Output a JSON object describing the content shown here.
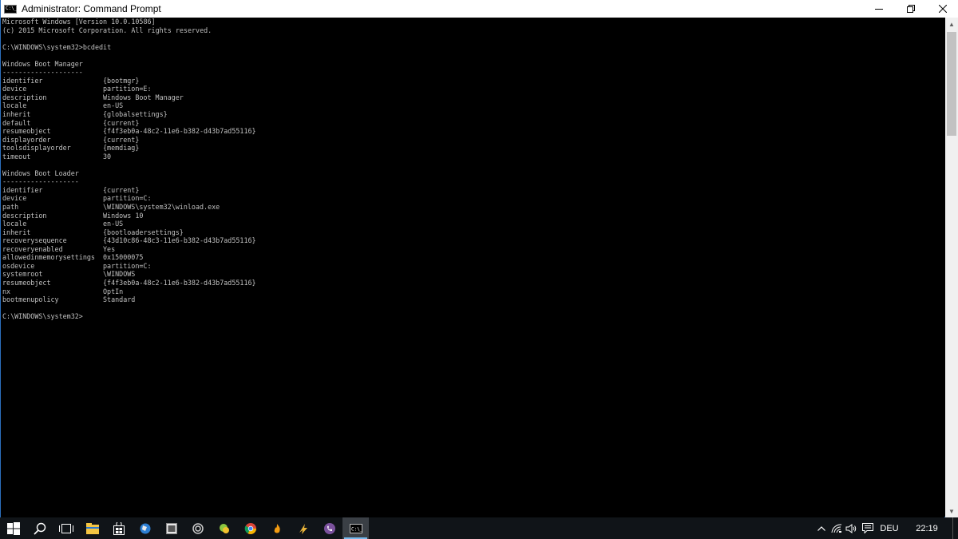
{
  "window": {
    "title": "Administrator: Command Prompt",
    "icon_label": "C:\\_"
  },
  "console": {
    "header_lines": [
      "Microsoft Windows [Version 10.0.10586]",
      "(c) 2015 Microsoft Corporation. All rights reserved."
    ],
    "command_line": "C:\\WINDOWS\\system32>bcdedit",
    "sections": [
      {
        "title": "Windows Boot Manager",
        "underline": "--------------------",
        "entries": [
          {
            "key": "identifier",
            "value": "{bootmgr}"
          },
          {
            "key": "device",
            "value": "partition=E:"
          },
          {
            "key": "description",
            "value": "Windows Boot Manager"
          },
          {
            "key": "locale",
            "value": "en-US"
          },
          {
            "key": "inherit",
            "value": "{globalsettings}"
          },
          {
            "key": "default",
            "value": "{current}"
          },
          {
            "key": "resumeobject",
            "value": "{f4f3eb0a-48c2-11e6-b382-d43b7ad55116}"
          },
          {
            "key": "displayorder",
            "value": "{current}"
          },
          {
            "key": "toolsdisplayorder",
            "value": "{memdiag}"
          },
          {
            "key": "timeout",
            "value": "30"
          }
        ]
      },
      {
        "title": "Windows Boot Loader",
        "underline": "-------------------",
        "entries": [
          {
            "key": "identifier",
            "value": "{current}"
          },
          {
            "key": "device",
            "value": "partition=C:"
          },
          {
            "key": "path",
            "value": "\\WINDOWS\\system32\\winload.exe"
          },
          {
            "key": "description",
            "value": "Windows 10"
          },
          {
            "key": "locale",
            "value": "en-US"
          },
          {
            "key": "inherit",
            "value": "{bootloadersettings}"
          },
          {
            "key": "recoverysequence",
            "value": "{43d10c86-48c3-11e6-b382-d43b7ad55116}"
          },
          {
            "key": "recoveryenabled",
            "value": "Yes"
          },
          {
            "key": "allowedinmemorysettings",
            "value": "0x15000075"
          },
          {
            "key": "osdevice",
            "value": "partition=C:"
          },
          {
            "key": "systemroot",
            "value": "\\WINDOWS"
          },
          {
            "key": "resumeobject",
            "value": "{f4f3eb0a-48c2-11e6-b382-d43b7ad55116}"
          },
          {
            "key": "nx",
            "value": "OptIn"
          },
          {
            "key": "bootmenupolicy",
            "value": "Standard"
          }
        ]
      }
    ],
    "prompt": "C:\\WINDOWS\\system32>"
  },
  "taskbar": {
    "apps": [
      {
        "name": "start-button",
        "icon": "windows-logo-icon"
      },
      {
        "name": "search-button",
        "icon": "search-icon"
      },
      {
        "name": "task-view-button",
        "icon": "task-view-icon"
      },
      {
        "name": "file-explorer-button",
        "icon": "folder-icon"
      },
      {
        "name": "store-button",
        "icon": "store-icon"
      },
      {
        "name": "app-button-1",
        "icon": "globe-icon"
      },
      {
        "name": "app-button-2",
        "icon": "window-icon"
      },
      {
        "name": "app-button-3",
        "icon": "gear-icon"
      },
      {
        "name": "app-button-4",
        "icon": "leaf-icon"
      },
      {
        "name": "chrome-button",
        "icon": "chrome-icon"
      },
      {
        "name": "app-button-5",
        "icon": "flame-icon"
      },
      {
        "name": "app-button-6",
        "icon": "bolt-icon"
      },
      {
        "name": "viber-button",
        "icon": "phone-icon"
      },
      {
        "name": "command-prompt-button",
        "icon": "terminal-icon"
      }
    ],
    "tray": {
      "language": "DEU",
      "time": "22:19"
    }
  },
  "colors": {
    "console_text": "#c0c0c0",
    "console_bg": "#000000",
    "taskbar_bg": "#101418",
    "accent": "#76b9ed"
  }
}
